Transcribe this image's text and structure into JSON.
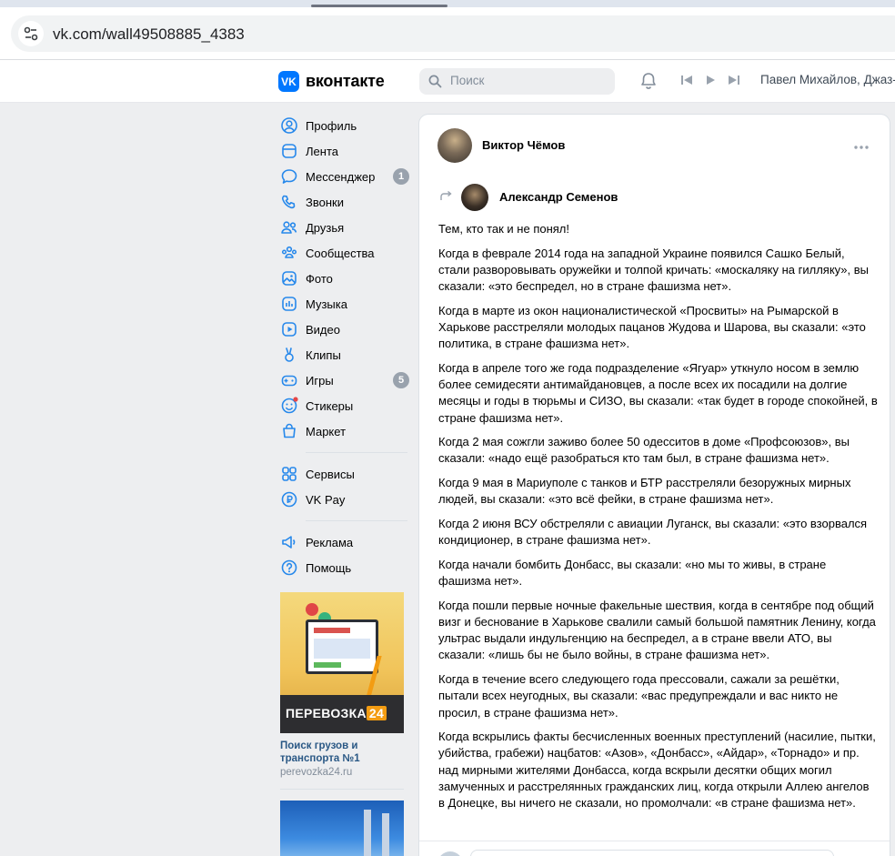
{
  "browser": {
    "url": "vk.com/wall49508885_4383"
  },
  "header": {
    "logo_text": "вконтакте",
    "search_placeholder": "Поиск",
    "now_playing": "Павел Михайлов, Джаз-"
  },
  "sidebar": {
    "items": [
      {
        "label": "Профиль",
        "icon": "profile-icon"
      },
      {
        "label": "Лента",
        "icon": "feed-icon"
      },
      {
        "label": "Мессенджер",
        "icon": "messenger-icon",
        "badge": "1"
      },
      {
        "label": "Звонки",
        "icon": "phone-icon"
      },
      {
        "label": "Друзья",
        "icon": "friends-icon"
      },
      {
        "label": "Сообщества",
        "icon": "communities-icon"
      },
      {
        "label": "Фото",
        "icon": "photo-icon"
      },
      {
        "label": "Музыка",
        "icon": "music-icon"
      },
      {
        "label": "Видео",
        "icon": "video-icon"
      },
      {
        "label": "Клипы",
        "icon": "clips-icon"
      },
      {
        "label": "Игры",
        "icon": "games-icon",
        "badge": "5"
      },
      {
        "label": "Стикеры",
        "icon": "stickers-icon"
      },
      {
        "label": "Маркет",
        "icon": "market-icon"
      }
    ],
    "items2": [
      {
        "label": "Сервисы",
        "icon": "services-icon"
      },
      {
        "label": "VK Pay",
        "icon": "vkpay-icon"
      }
    ],
    "items3": [
      {
        "label": "Реклама",
        "icon": "ads-icon"
      },
      {
        "label": "Помощь",
        "icon": "help-icon"
      }
    ],
    "ad": {
      "banner_text": "ПЕРЕВОЗКА",
      "banner_num": "24",
      "title": "Поиск грузов и транспорта №1",
      "domain": "perevozka24.ru"
    }
  },
  "post": {
    "author": "Виктор Чёмов",
    "repost_author": "Александр Семенов",
    "paragraphs": [
      "Тем, кто так и не понял!",
      "Когда в феврале 2014 года на западной Украине появился Сашко Белый, стали разворовывать оружейки и толпой кричать: «москаляку на гилляку», вы сказали: «это беспредел, но в стране фашизма нет».",
      "Когда в марте из окон националистической «Просвиты» на Рымарской в Харькове расстреляли молодых пацанов Жудова и Шарова, вы сказали: «это политика, в стране фашизма нет».",
      "Когда в апреле того же года подразделение «Ягуар» уткнуло носом в землю более семидесяти антимайдановцев, а после всех их посадили на долгие месяцы и годы в тюрьмы и СИЗО, вы сказали: «так будет в городе спокойней, в стране фашизма нет».",
      "Когда 2 мая сожгли заживо более 50 одесситов в доме «Профсоюзов», вы сказали: «надо ещё разобраться кто там был, в стране фашизма нет».",
      "Когда 9 мая в Мариуполе с танков и БТР расстреляли безоружных мирных людей, вы сказали: «это всё фейки, в стране фашизма нет».",
      "Когда 2 июня ВСУ обстреляли с авиации Луганск, вы сказали: «это взорвался кондиционер, в стране фашизма нет».",
      "Когда начали бомбить Донбасс, вы сказали: «но мы то живы, в стране фашизма нет».",
      "Когда пошли первые ночные факельные шествия, когда в сентябре под общий визг и беснование в Харькове свалили самый большой памятник Ленину, когда ультрас выдали индульгенцию на беспредел, а в стране ввели АТО, вы сказали: «лишь бы не было войны, в стране фашизма нет».",
      "Когда в течение всего следующего года прессовали, сажали за решётки, пытали всех неугодных, вы сказали: «вас предупреждали и вас никто не просил, в стране фашизма нет».",
      "Когда вскрылись факты бесчисленных военных преступлений (насилие, пытки, убийства, грабежи) нацбатов: «Азов», «Донбасс», «Айдар», «Торнадо» и пр. над мирными жителями Донбасса, когда вскрыли десятки общих могил замученных и расстрелянных гражданских лиц, когда открыли Аллею ангелов в Донецке, вы ничего не сказали, но промолчали: «в стране фашизма нет»."
    ]
  },
  "colors": {
    "vk_blue": "#0077ff",
    "link": "#2a5885",
    "badge": "#99a2ad",
    "page_bg": "#edeef0"
  }
}
